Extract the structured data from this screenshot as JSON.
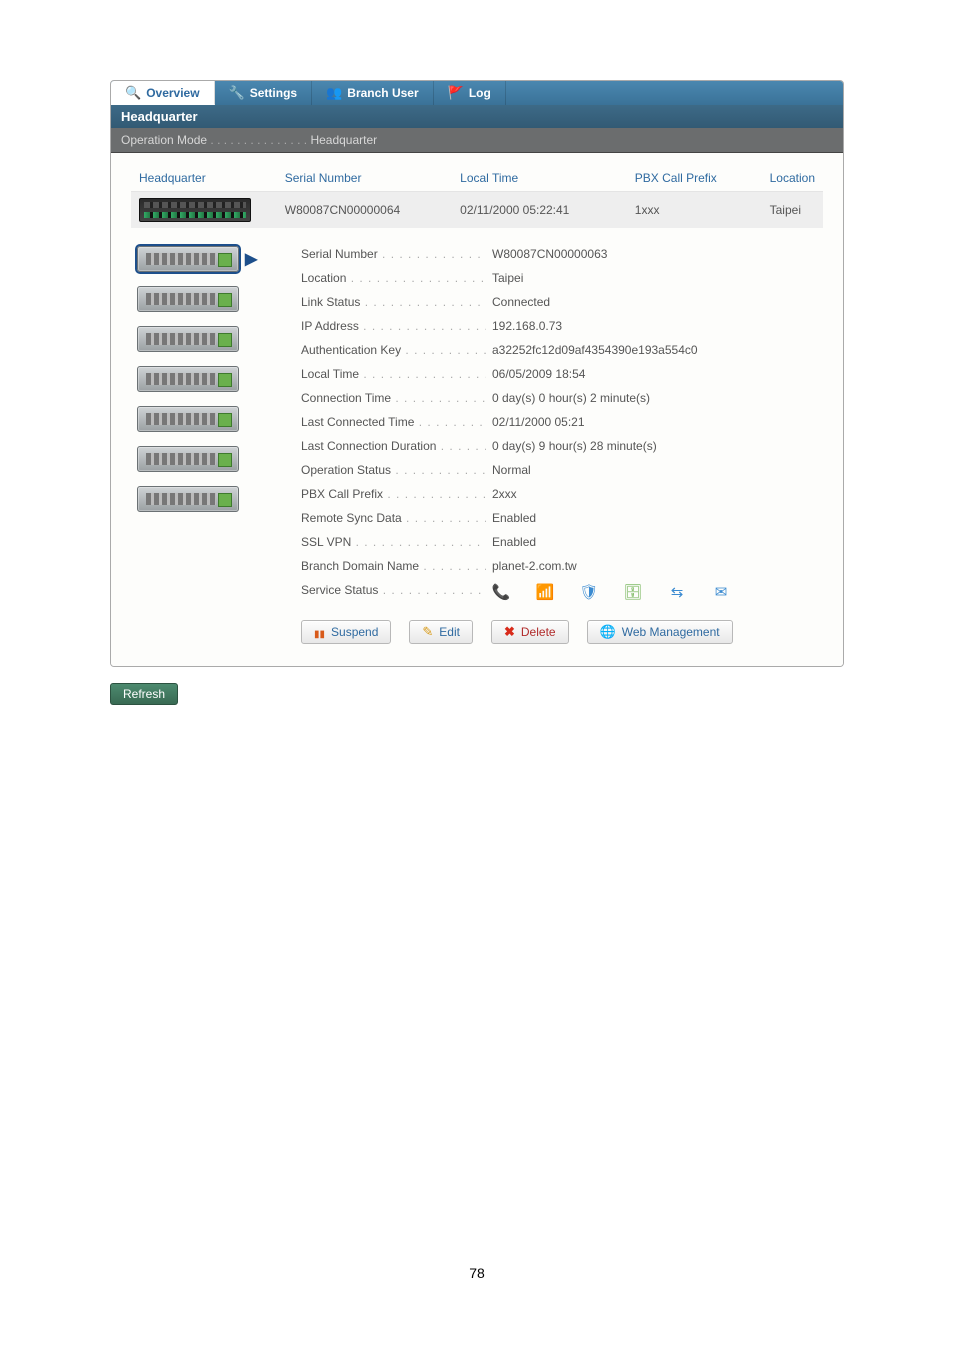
{
  "page_number": "78",
  "tabs": [
    {
      "label": "Overview",
      "active": true
    },
    {
      "label": "Settings"
    },
    {
      "label": "Branch User"
    },
    {
      "label": "Log"
    }
  ],
  "title": "Headquarter",
  "operation_mode": {
    "label": "Operation Mode",
    "value": "Headquarter"
  },
  "table": {
    "headers": {
      "c0": "Headquarter",
      "c1": "Serial Number",
      "c2": "Local Time",
      "c3": "PBX Call Prefix",
      "c4": "Location"
    },
    "row": {
      "serial": "W80087CN00000064",
      "local_time": "02/11/2000 05:22:41",
      "prefix": "1xxx",
      "location": "Taipei"
    }
  },
  "details": [
    {
      "label": "Serial Number",
      "value": "W80087CN00000063"
    },
    {
      "label": "Location",
      "value": "Taipei"
    },
    {
      "label": "Link Status",
      "value": "Connected"
    },
    {
      "label": "IP Address",
      "value": "192.168.0.73"
    },
    {
      "label": "Authentication Key",
      "value": "a32252fc12d09af4354390e193a554c0"
    },
    {
      "label": "Local Time",
      "value": "06/05/2009 18:54"
    },
    {
      "label": "Connection Time",
      "value": "0 day(s) 0 hour(s) 2 minute(s)"
    },
    {
      "label": "Last Connected Time",
      "value": "02/11/2000 05:21"
    },
    {
      "label": "Last Connection Duration",
      "value": "0 day(s) 9 hour(s) 28 minute(s)"
    },
    {
      "label": "Operation Status",
      "value": "Normal"
    },
    {
      "label": "PBX Call Prefix",
      "value": "2xxx"
    },
    {
      "label": "Remote Sync Data",
      "value": "Enabled"
    },
    {
      "label": "SSL VPN",
      "value": "Enabled"
    },
    {
      "label": "Branch Domain Name",
      "value": "planet-2.com.tw"
    }
  ],
  "service_status_label": "Service Status",
  "buttons": {
    "suspend": "Suspend",
    "edit": "Edit",
    "delete": "Delete",
    "web": "Web Management"
  },
  "refresh": "Refresh"
}
